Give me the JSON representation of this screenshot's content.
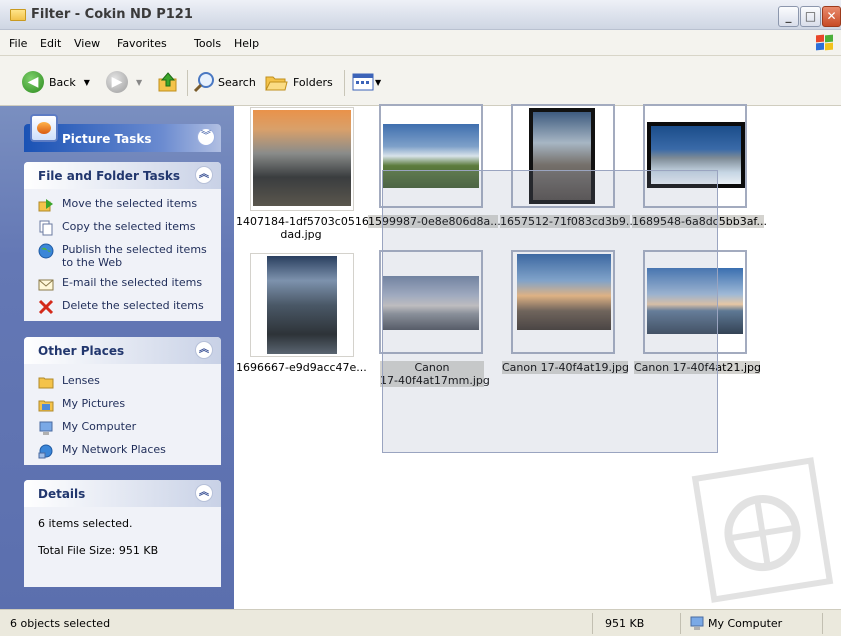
{
  "window": {
    "title": "Filter - Cokin  ND P121"
  },
  "menu": [
    "File",
    "Edit",
    "View",
    "Favorites",
    "Tools",
    "Help"
  ],
  "toolbar": {
    "back": "Back",
    "search": "Search",
    "folders": "Folders"
  },
  "picture_tasks": {
    "title": "Picture Tasks"
  },
  "file_folder_tasks": {
    "title": "File and Folder Tasks",
    "items": [
      "Move the selected items",
      "Copy the selected items",
      "Publish the selected items to the Web",
      "E-mail the selected items",
      "Delete the selected items"
    ]
  },
  "other_places": {
    "title": "Other Places",
    "items": [
      "Lenses",
      "My Pictures",
      "My Computer",
      "My Network Places"
    ]
  },
  "details": {
    "title": "Details",
    "selected_count": "6 items selected.",
    "total_size": "Total File Size: 951 KB"
  },
  "files": [
    {
      "name_line1": "1407184-1df5703c05161",
      "name_line2": "dad.jpg",
      "selected": false
    },
    {
      "name_line1": "1599987-0e8e806d8a...",
      "name_line2": "",
      "selected": true
    },
    {
      "name_line1": "1657512-71f083cd3b9...",
      "name_line2": "",
      "selected": true
    },
    {
      "name_line1": "1689548-6a8dc5bb3af...",
      "name_line2": "",
      "selected": true
    },
    {
      "name_line1": "1696667-e9d9acc47e...",
      "name_line2": "",
      "selected": false
    },
    {
      "name_line1": "Canon",
      "name_line2": "17-40f4at17mm.jpg",
      "selected": true
    },
    {
      "name_line1": "Canon 17-40f4at19.jpg",
      "name_line2": "",
      "selected": true
    },
    {
      "name_line1": "Canon 17-40f4at21.jpg",
      "name_line2": "",
      "selected": true
    }
  ],
  "statusbar": {
    "objects": "6 objects selected",
    "size": "951 KB",
    "location": "My Computer"
  }
}
